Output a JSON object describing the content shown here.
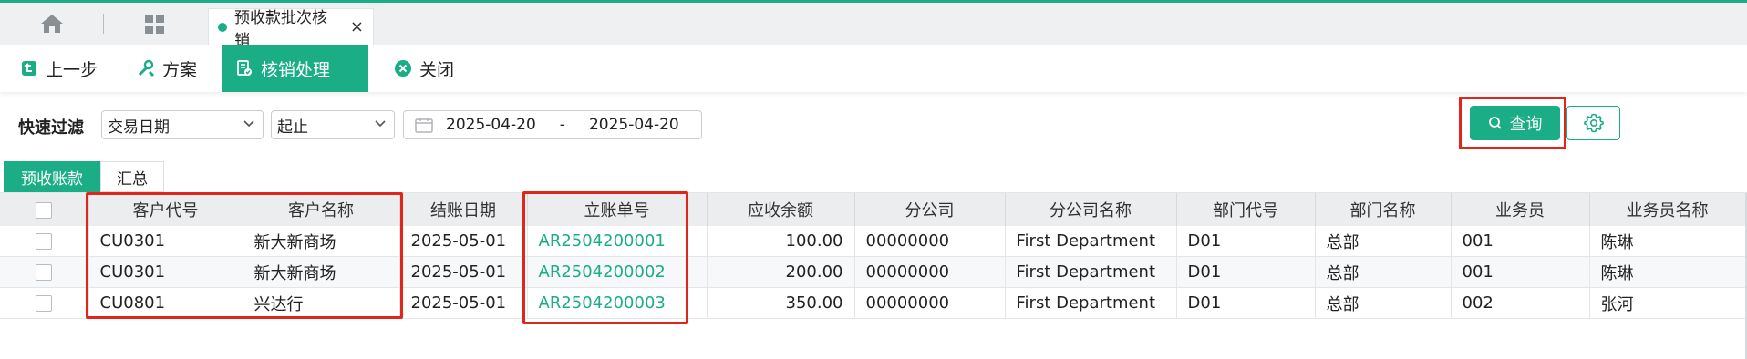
{
  "tabbar": {
    "home_icon": "home-icon",
    "apps_icon": "grid-icon",
    "active_tab": "预收款批次核销",
    "close_glyph": "×"
  },
  "toolbar": {
    "prev_label": "上一步",
    "plan_label": "方案",
    "process_label": "核销处理",
    "close_label": "关闭"
  },
  "filter": {
    "label": "快速过滤",
    "field_select": "交易日期",
    "range_select": "起止",
    "date_from": "2025-04-20",
    "date_sep": "-",
    "date_to": "2025-04-20",
    "query_label": "查询"
  },
  "subtabs": [
    "预收账款",
    "汇总"
  ],
  "table": {
    "columns": [
      "客户代号",
      "客户名称",
      "结账日期",
      "立账单号",
      "应收余额",
      "分公司",
      "分公司名称",
      "部门代号",
      "部门名称",
      "业务员",
      "业务员名称"
    ],
    "rows": [
      [
        "CU0301",
        "新大新商场",
        "2025-05-01",
        "AR2504200001",
        "100.00",
        "00000000",
        "First Department",
        "D01",
        "总部",
        "001",
        "陈琳"
      ],
      [
        "CU0301",
        "新大新商场",
        "2025-05-01",
        "AR2504200002",
        "200.00",
        "00000000",
        "First Department",
        "D01",
        "总部",
        "001",
        "陈琳"
      ],
      [
        "CU0801",
        "兴达行",
        "2025-05-01",
        "AR2504200003",
        "350.00",
        "00000000",
        "First Department",
        "D01",
        "总部",
        "002",
        "张河"
      ]
    ]
  },
  "colors": {
    "accent": "#1aad86",
    "highlight": "#e1251b"
  }
}
